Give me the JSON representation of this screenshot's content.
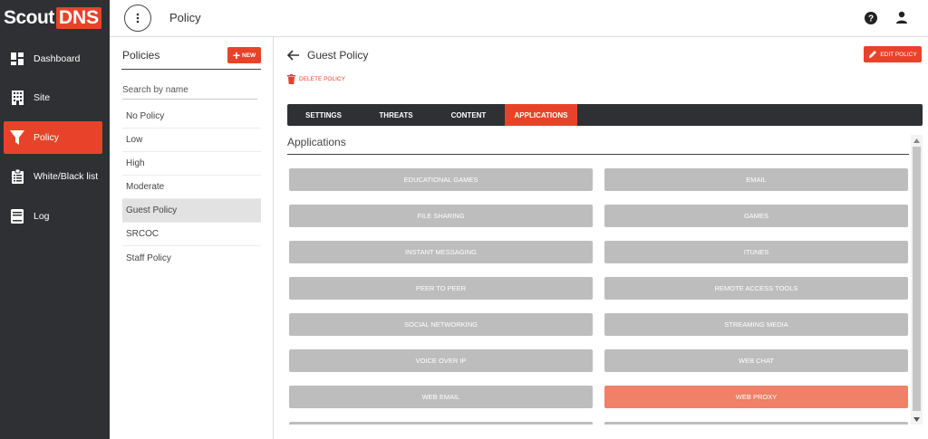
{
  "brand": {
    "part1": "Scout",
    "part2": "DNS"
  },
  "nav": {
    "items": [
      {
        "label": "Dashboard",
        "icon": "dashboard-icon",
        "active": false
      },
      {
        "label": "Site",
        "icon": "building-icon",
        "active": false
      },
      {
        "label": "Policy",
        "icon": "filter-icon",
        "active": true
      },
      {
        "label": "White/Black list",
        "icon": "clipboard-list-icon",
        "active": false
      },
      {
        "label": "Log",
        "icon": "book-icon",
        "active": false
      }
    ]
  },
  "header": {
    "title": "Policy",
    "help_icon": "help-icon",
    "user_icon": "user-icon"
  },
  "policies": {
    "title": "Policies",
    "new_label": "NEW",
    "search_placeholder": "Search by name",
    "items": [
      "No Policy",
      "Low",
      "High",
      "Moderate",
      "Guest Policy",
      "SRCOC",
      "Staff Policy"
    ],
    "selected": "Guest Policy"
  },
  "detail": {
    "title": "Guest Policy",
    "edit_label": "EDIT POLICY",
    "delete_label": "DELETE POLICY",
    "tabs": [
      "SETTINGS",
      "THREATS",
      "CONTENT",
      "APPLICATIONS"
    ],
    "active_tab": "APPLICATIONS",
    "section_title": "Applications"
  },
  "applications": [
    {
      "label": "EDUCATIONAL GAMES",
      "blocked": false
    },
    {
      "label": "EMAIL",
      "blocked": false
    },
    {
      "label": "FILE SHARING",
      "blocked": false
    },
    {
      "label": "GAMES",
      "blocked": false
    },
    {
      "label": "INSTANT MESSAGING",
      "blocked": false
    },
    {
      "label": "ITUNES",
      "blocked": false
    },
    {
      "label": "PEER TO PEER",
      "blocked": false
    },
    {
      "label": "REMOTE ACCESS TOOLS",
      "blocked": false
    },
    {
      "label": "SOCIAL NETWORKING",
      "blocked": false
    },
    {
      "label": "STREAMING MEDIA",
      "blocked": false
    },
    {
      "label": "VOICE OVER IP",
      "blocked": false
    },
    {
      "label": "WEB CHAT",
      "blocked": false
    },
    {
      "label": "WEB EMAIL",
      "blocked": false
    },
    {
      "label": "WEB PROXY",
      "blocked": true
    },
    {
      "label": "",
      "blocked": false
    },
    {
      "label": "",
      "blocked": false
    }
  ],
  "colors": {
    "accent": "#e8432a",
    "nav_bg": "#2f3033",
    "app_off": "#bdbdbd",
    "app_on": "#f08068"
  }
}
